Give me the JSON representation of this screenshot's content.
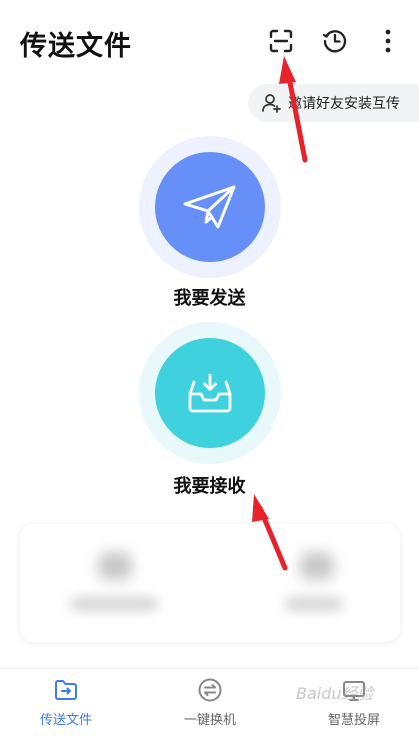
{
  "header": {
    "title": "传送文件",
    "scan_icon": "scan-icon",
    "history_icon": "history-clock-icon",
    "more_icon": "more-vertical-icon"
  },
  "invite": {
    "text": "邀请好友安装互传",
    "icon": "add-user-icon"
  },
  "send": {
    "label": "我要发送",
    "icon": "paper-plane-icon",
    "color": "#6690f8"
  },
  "receive": {
    "label": "我要接收",
    "icon": "inbox-download-icon",
    "color": "#3fd2de"
  },
  "tabs": [
    {
      "label": "传送文件",
      "icon": "folder-transfer-icon",
      "active": true
    },
    {
      "label": "一键换机",
      "icon": "swap-icon",
      "active": false
    },
    {
      "label": "智慧投屏",
      "icon": "screen-cast-icon",
      "active": false
    }
  ],
  "watermark": "Baidu经验",
  "colors": {
    "accent": "#3b7cf6",
    "annotation_arrow": "#e8222b"
  }
}
